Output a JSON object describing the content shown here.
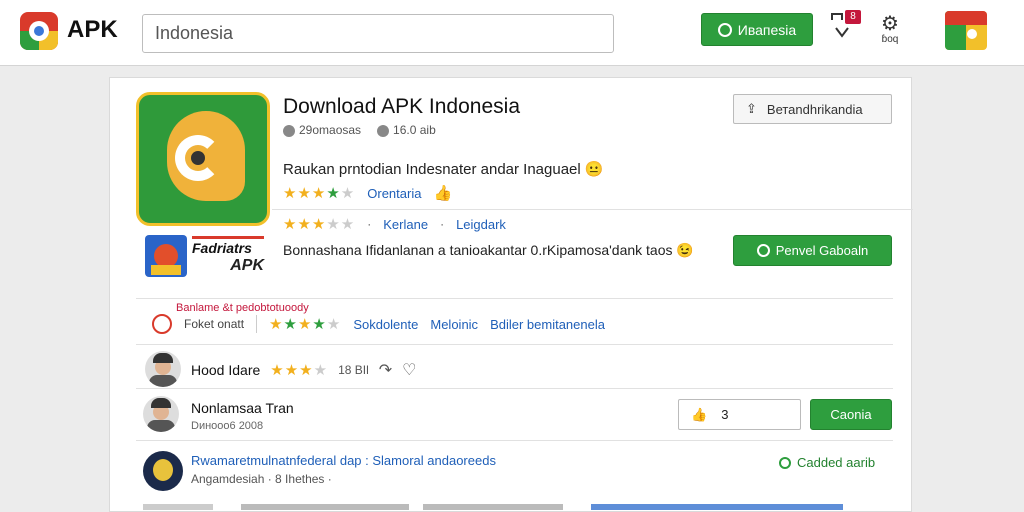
{
  "header": {
    "brand": "APK",
    "search_value": "Indonesia",
    "language_button": "Ивапеsia",
    "notification_badge": "8",
    "settings_label": "ɓoq"
  },
  "app": {
    "title": "Download APK Indonesia",
    "meta_downloads": "29omaosas",
    "meta_size": "16.0 aib",
    "download_button": "Ветаndhrikandia",
    "description": "Raukan prntodian Indesnater andar Inaguael 😐",
    "row1_link": "Orentaria",
    "row2_link1": "Kerlane",
    "row2_link2": "Leigdark",
    "description2": "Bonnashana Ifidanlanan a tanioakantar 0.rKipamosa'dank taos 😉",
    "primary_button": "Penvel Gaboaln"
  },
  "thumbnail2": {
    "line1": "Fadriatrs",
    "line2": "APK"
  },
  "review_section": {
    "heading": "Banlame &t pedobtotuoody",
    "sub": "Foket onatt",
    "link1": "Sokdolente",
    "link2": "Meloinic",
    "link3": "Bdiler bemitanenela"
  },
  "reviews": [
    {
      "name": "Hood Idare",
      "rating_text": "18 BIl"
    },
    {
      "name": "Nonlamsaa Tran",
      "sub": "Dинооо6 2008",
      "count": "3",
      "button": "Caonia"
    },
    {
      "title": "Rwamaretmulnatnfederal dap : Slamoral andaoreeds",
      "sub": "Angamdesiah · 8 Ihethes ·",
      "action": "Cadded aarib"
    }
  ],
  "colors": {
    "accent_green": "#2e9e3e",
    "link_blue": "#1f5fb8",
    "star_gold": "#f2b01e",
    "badge_red": "#c4173c"
  }
}
